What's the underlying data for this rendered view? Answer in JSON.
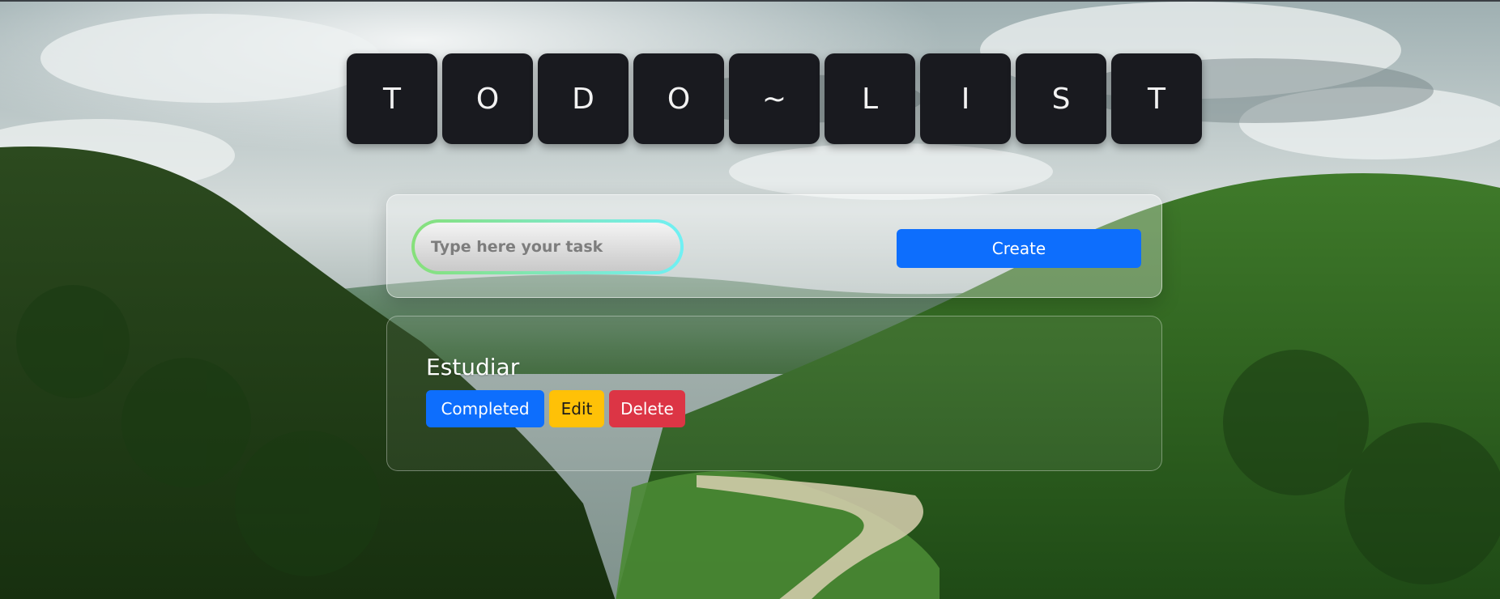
{
  "title_tiles": [
    "T",
    "O",
    "D",
    "O",
    "~",
    "L",
    "I",
    "S",
    "T"
  ],
  "form": {
    "input_placeholder": "Type here your task",
    "input_value": "",
    "create_label": "Create"
  },
  "tasks": [
    {
      "name": "Estudiar",
      "completed_label": "Completed",
      "edit_label": "Edit",
      "delete_label": "Delete"
    }
  ],
  "colors": {
    "tile_bg": "#191a1f",
    "primary": "#0d6efd",
    "warning": "#ffc107",
    "danger": "#dc3545"
  }
}
